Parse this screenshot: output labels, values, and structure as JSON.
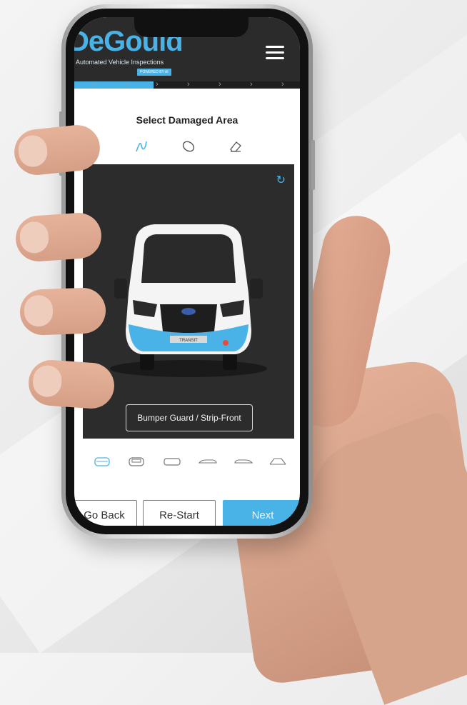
{
  "app": {
    "brand": "DeGould",
    "tagline": "Automated Vehicle Inspections",
    "powered_badge": "POWERED BY AI"
  },
  "header": {
    "menu_icon": "hamburger-menu-icon"
  },
  "progress": {
    "completed_fraction": 0.35,
    "steps_visible": 7
  },
  "inspection": {
    "title": "Select Damaged Area",
    "tools": [
      {
        "name": "scratch-tool-icon",
        "active": true
      },
      {
        "name": "dent-tool-icon",
        "active": false
      },
      {
        "name": "eraser-tool-icon",
        "active": false
      }
    ],
    "selected_area": "Bumper Guard / Strip-Front",
    "refresh_icon": "refresh-icon",
    "vehicle_badge": "TRANSIT"
  },
  "views": [
    {
      "name": "front-view-icon",
      "active": true
    },
    {
      "name": "rear-view-icon",
      "active": false
    },
    {
      "name": "top-view-icon",
      "active": false
    },
    {
      "name": "left-side-view-icon",
      "active": false
    },
    {
      "name": "right-side-view-icon",
      "active": false
    },
    {
      "name": "underside-view-icon",
      "active": false
    }
  ],
  "footer": {
    "back_label": "Go Back",
    "restart_label": "Re-Start",
    "next_label": "Next"
  },
  "colors": {
    "accent": "#49b3e7",
    "header": "#2b2b2b",
    "viewer": "#2c2c2c"
  }
}
